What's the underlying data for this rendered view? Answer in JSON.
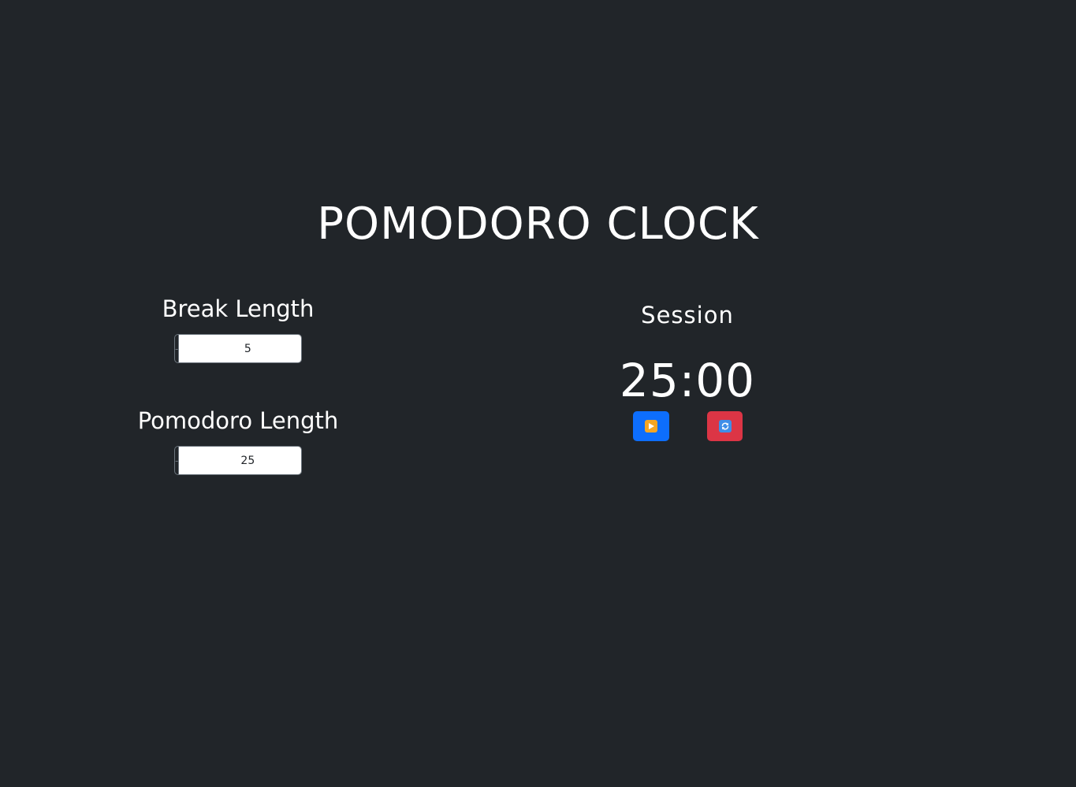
{
  "app": {
    "title": "POMODORO CLOCK"
  },
  "break_setting": {
    "label": "Break Length",
    "value": "5",
    "decrement_label": "-",
    "increment_label": "+"
  },
  "pomodoro_setting": {
    "label": "Pomodoro Length",
    "value": "25",
    "decrement_label": "-",
    "increment_label": "+"
  },
  "session": {
    "label": "Session",
    "time": "25:00"
  },
  "controls": {
    "play_icon": "play-icon",
    "reset_icon": "reset-icon",
    "play_color": "#0d6efd",
    "reset_color": "#dc3545"
  },
  "theme": {
    "background": "#212529",
    "text": "#ffffff",
    "border": "#6c757d"
  }
}
